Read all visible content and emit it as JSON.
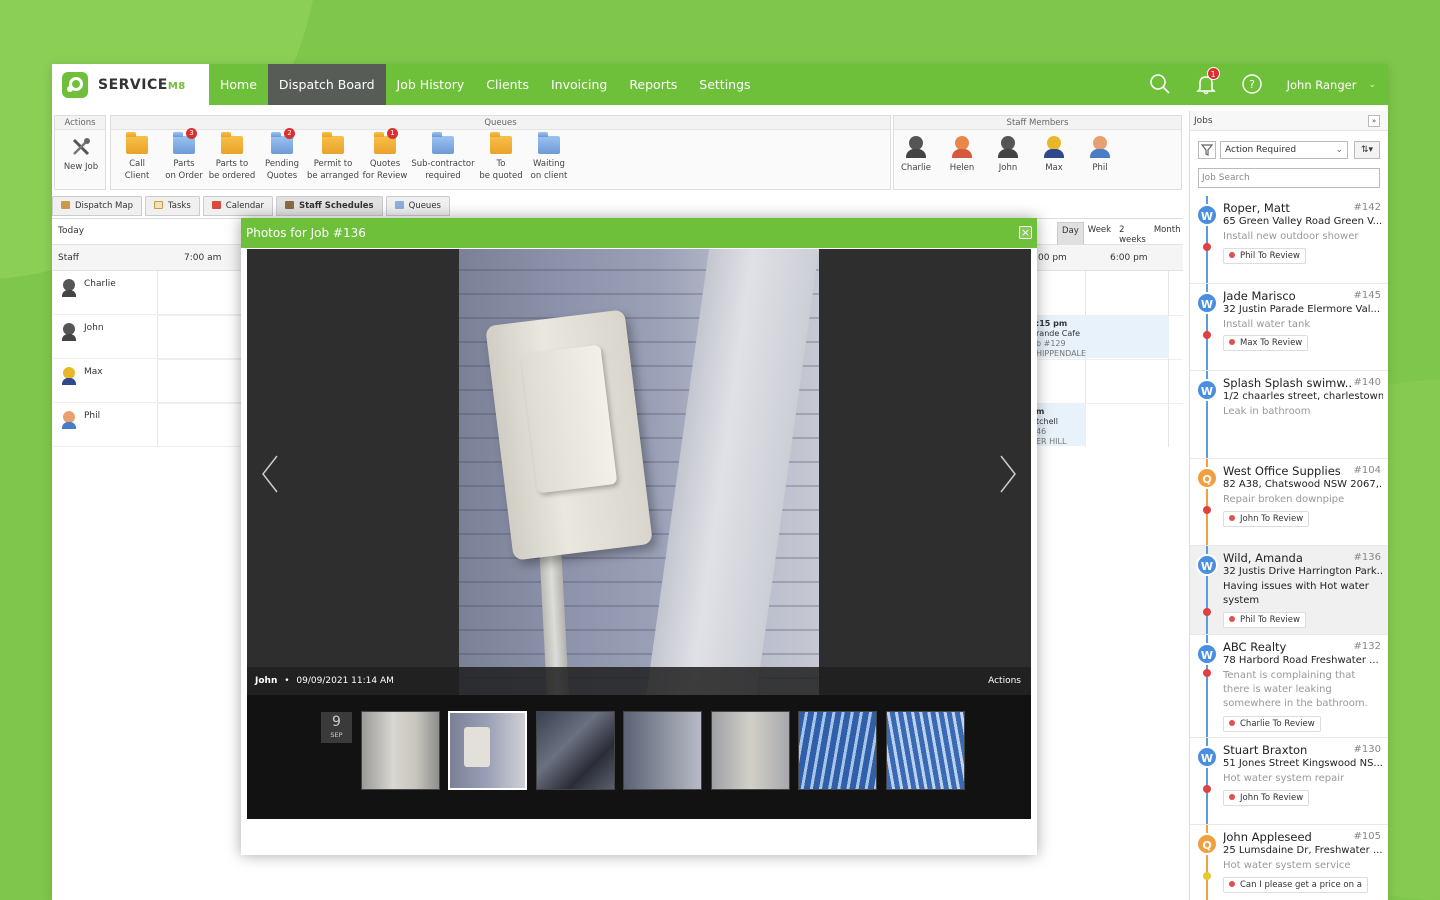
{
  "nav": {
    "logo_main": "SERVICE",
    "logo_sub": "M8",
    "items": [
      {
        "label": "Home",
        "active": false
      },
      {
        "label": "Dispatch Board",
        "active": true
      },
      {
        "label": "Job History",
        "active": false
      },
      {
        "label": "Clients",
        "active": false
      },
      {
        "label": "Invoicing",
        "active": false
      },
      {
        "label": "Reports",
        "active": false
      },
      {
        "label": "Settings",
        "active": false
      }
    ],
    "notification_count": "1",
    "user": "John Ranger",
    "accent_color": "#6ec03b"
  },
  "toolbar": {
    "actions_label": "Actions",
    "new_job_label": "New Job",
    "queues_label": "Queues",
    "queues": [
      {
        "line1": "Call",
        "line2": "Client",
        "badge": ""
      },
      {
        "line1": "Parts",
        "line2": "on Order",
        "badge": "3"
      },
      {
        "line1": "Parts to",
        "line2": "be ordered",
        "badge": ""
      },
      {
        "line1": "Pending",
        "line2": "Quotes",
        "badge": "2"
      },
      {
        "line1": "Permit to",
        "line2": "be arranged",
        "badge": ""
      },
      {
        "line1": "Quotes",
        "line2": "for Review",
        "badge": "1"
      },
      {
        "line1": "Sub-contractor",
        "line2": "required",
        "badge": ""
      },
      {
        "line1": "To",
        "line2": "be quoted",
        "badge": ""
      },
      {
        "line1": "Waiting",
        "line2": "on client",
        "badge": ""
      }
    ],
    "staff_label": "Staff Members",
    "staff": [
      "Charlie",
      "Helen",
      "John",
      "Max",
      "Phil"
    ]
  },
  "tabs": [
    "Dispatch Map",
    "Tasks",
    "Calendar",
    "Staff Schedules",
    "Queues"
  ],
  "schedule": {
    "today_label": "Today",
    "staff_header": "Staff",
    "time_first": "7:00 am",
    "time_mid": ":00 pm",
    "time_last": "6:00 pm",
    "view_buttons": [
      "Day",
      "Week",
      "2 weeks",
      "Month"
    ],
    "staff": [
      "Charlie",
      "John",
      "Max",
      "Phil"
    ],
    "appt1": {
      "time": ":15 pm",
      "name": "rande Cafe",
      "job": "b #129",
      "suburb": "HIPPENDALE"
    },
    "appt2": {
      "name": "m",
      "line2": "tchell",
      "job": "46",
      "suburb": "ER HILL"
    }
  },
  "photo_viewer": {
    "title": "Photos for Job #136",
    "caption_user": "John",
    "caption_time": "09/09/2021 11:14 AM",
    "actions_label": "Actions",
    "date_day": "9",
    "date_month": "SEP",
    "selected_index": 1,
    "thumb_count": 7
  },
  "jobs_panel": {
    "title": "Jobs",
    "filter_value": "Action Required",
    "search_placeholder": "Job Search",
    "jobs": [
      {
        "badge": "W",
        "name": "Roper, Matt",
        "number": "#142",
        "address": "65 Green Valley Road Green V...",
        "description": "Install new outdoor shower",
        "tag": "Phil To Review"
      },
      {
        "badge": "W",
        "name": "Jade Marisco",
        "number": "#145",
        "address": "32 Justin Parade Elermore Val...",
        "description": "Install water tank",
        "tag": "Max To Review"
      },
      {
        "badge": "W",
        "name": "Splash Splash swimw...",
        "number": "#140",
        "address": "1/2 chaarles street, charlestown",
        "description": "Leak in bathroom",
        "tag": ""
      },
      {
        "badge": "Q",
        "name": "West Office Supplies",
        "number": "#104",
        "address": "82 A38, Chatswood NSW 2067,...",
        "description": "Repair broken downpipe",
        "tag": "John To Review"
      },
      {
        "badge": "W",
        "name": "Wild, Amanda",
        "number": "#136",
        "address": "32 Justis Drive Harrington Park...",
        "description": "Having issues with Hot water system",
        "tag": "Phil To Review"
      },
      {
        "badge": "W",
        "name": "ABC Realty",
        "number": "#132",
        "address": "78 Harbord Road Freshwater ...",
        "description": "Tenant is complaining that there is water leaking somewhere in the bathroom.",
        "tag": "Charlie To Review"
      },
      {
        "badge": "W",
        "name": "Stuart Braxton",
        "number": "#130",
        "address": "51 Jones Street Kingswood NS...",
        "description": "Hot water system repair",
        "tag": "John To Review"
      },
      {
        "badge": "Q",
        "name": "John Appleseed",
        "number": "#105",
        "address": "25 Lumsdaine Dr, Freshwater ...",
        "description": "Hot water system service",
        "tag": "Can I please get a price on a"
      }
    ]
  }
}
